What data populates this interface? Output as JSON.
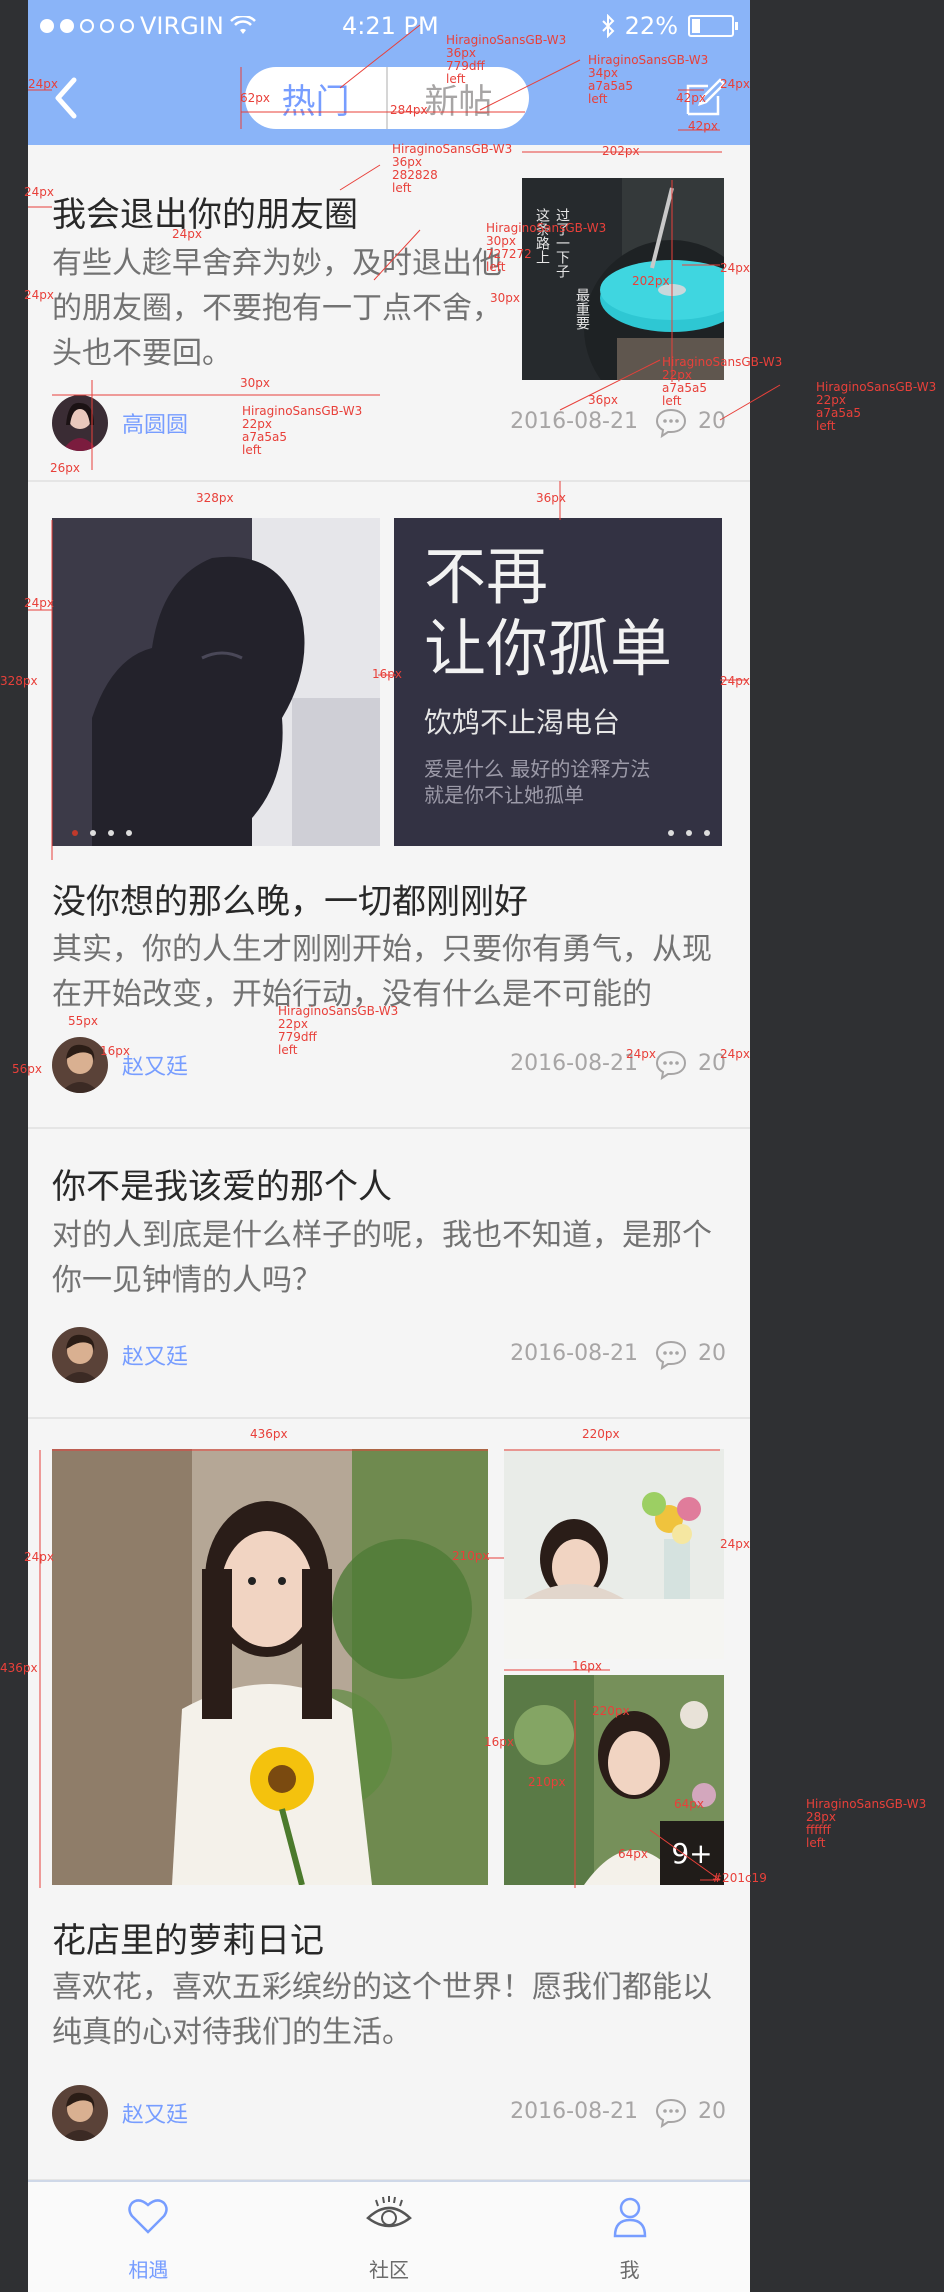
{
  "status_bar": {
    "carrier": "VIRGIN",
    "time": "4:21 PM",
    "battery": "22%"
  },
  "header": {
    "tabs": [
      {
        "label": "热门",
        "active": true
      },
      {
        "label": "新帖",
        "active": false
      }
    ]
  },
  "posts": [
    {
      "title": "我会退出你的朋友圈",
      "summary": "有些人趁早舍弃为妙，及时退出他的朋友圈，不要抱有一丁点不舍，头也不要回。",
      "author": "高圆圆",
      "date": "2016-08-21",
      "comments": "20",
      "thumb_text": [
        "这条路上",
        "过了一下子",
        "最重要"
      ]
    },
    {
      "title": "没你想的那么晚，一切都刚刚好",
      "summary": "其实，你的人生才刚刚开始，只要你有勇气，从现在开始改变，开始行动，没有什么是不可能的",
      "author": "赵又廷",
      "date": "2016-08-21",
      "comments": "20",
      "poster": {
        "line1": "不再",
        "line2": "让你孤单",
        "line3": "饮鸩不止渴电台",
        "line4": "爱是什么 最好的诠释方法",
        "line5": "就是你不让她孤单"
      }
    },
    {
      "title": "你不是我该爱的那个人",
      "summary": "对的人到底是什么样子的呢，我也不知道，是那个你一见钟情的人吗？",
      "author": "赵又廷",
      "date": "2016-08-21",
      "comments": "20"
    },
    {
      "title": "花店里的萝莉日记",
      "summary": "喜欢花，喜欢五彩缤纷的这个世界！愿我们都能以纯真的心对待我们的生活。",
      "author": "赵又廷",
      "date": "2016-08-21",
      "comments": "20",
      "more_badge": "9+"
    }
  ],
  "tabbar": [
    {
      "label": "相遇",
      "active": true
    },
    {
      "label": "社区",
      "active": false
    },
    {
      "label": "我",
      "active": false
    }
  ],
  "colors": {
    "header_bg": "#8ab4f8",
    "accent": "#779dff",
    "title": "#282828",
    "summary": "#727272",
    "meta": "#a7a5a5"
  },
  "annotations": [
    {
      "text": "24px"
    },
    {
      "text": "62px"
    },
    {
      "text": "284px"
    },
    {
      "text": "HiraginoSansGB-W3"
    },
    {
      "text": "36px"
    },
    {
      "text": "779dff"
    },
    {
      "text": "left"
    },
    {
      "text": "HiraginoSansGB-W3"
    },
    {
      "text": "34px"
    },
    {
      "text": "a7a5a5"
    },
    {
      "text": "left"
    },
    {
      "text": "24px"
    },
    {
      "text": "42px"
    },
    {
      "text": "42px"
    },
    {
      "text": "HiraginoSansGB-W3"
    },
    {
      "text": "36px"
    },
    {
      "text": "282828"
    },
    {
      "text": "left"
    },
    {
      "text": "202px"
    },
    {
      "text": "24px"
    },
    {
      "text": "24px"
    },
    {
      "text": "HiraginoSansGB-W3"
    },
    {
      "text": "30px"
    },
    {
      "text": "727272"
    },
    {
      "text": "left"
    },
    {
      "text": "202px"
    },
    {
      "text": "24px"
    },
    {
      "text": "24px"
    },
    {
      "text": "30px"
    },
    {
      "text": "30px"
    },
    {
      "text": "HiraginoSansGB-W3"
    },
    {
      "text": "22px"
    },
    {
      "text": "a7a5a5"
    },
    {
      "text": "left"
    },
    {
      "text": "36px"
    },
    {
      "text": "HiraginoSansGB-W3"
    },
    {
      "text": "22px"
    },
    {
      "text": "a7a5a5"
    },
    {
      "text": "left"
    },
    {
      "text": "HiraginoSansGB-W3"
    },
    {
      "text": "22px"
    },
    {
      "text": "a7a5a5"
    },
    {
      "text": "left"
    },
    {
      "text": "26px"
    },
    {
      "text": "328px"
    },
    {
      "text": "36px"
    },
    {
      "text": "24px"
    },
    {
      "text": "328px"
    },
    {
      "text": "16px"
    },
    {
      "text": "24px"
    },
    {
      "text": "55px"
    },
    {
      "text": "16px"
    },
    {
      "text": "56px"
    },
    {
      "text": "HiraginoSansGB-W3"
    },
    {
      "text": "22px"
    },
    {
      "text": "779dff"
    },
    {
      "text": "left"
    },
    {
      "text": "24px"
    },
    {
      "text": "24px"
    },
    {
      "text": "436px"
    },
    {
      "text": "220px"
    },
    {
      "text": "24px"
    },
    {
      "text": "210px"
    },
    {
      "text": "24px"
    },
    {
      "text": "436px"
    },
    {
      "text": "16px"
    },
    {
      "text": "220px"
    },
    {
      "text": "16px"
    },
    {
      "text": "210px"
    },
    {
      "text": "64px"
    },
    {
      "text": "64px"
    },
    {
      "text": "HiraginoSansGB-W3"
    },
    {
      "text": "28px"
    },
    {
      "text": "ffffff"
    },
    {
      "text": "left"
    },
    {
      "text": "#201c19"
    }
  ]
}
